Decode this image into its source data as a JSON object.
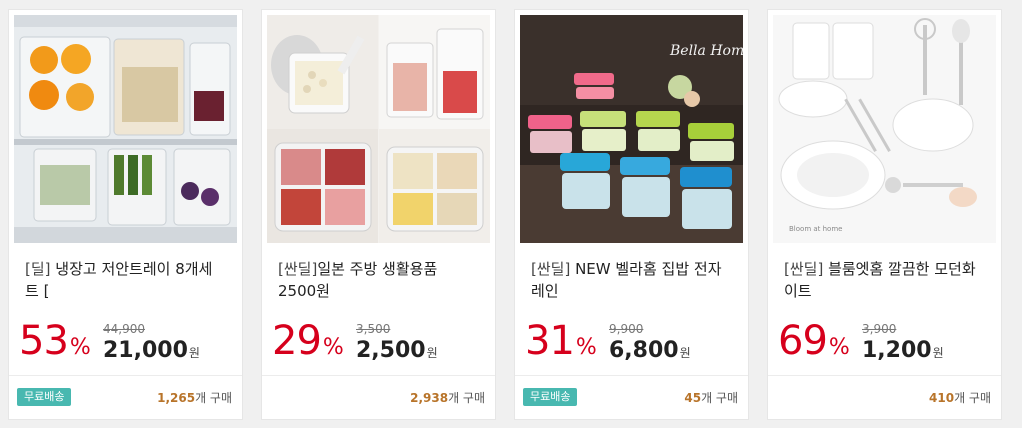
{
  "products": [
    {
      "image": "fridge-tray-photo",
      "tag": "[딜]",
      "title": " 냉장고 저안트레이 8개세트 [",
      "discount": "53",
      "discount_unit": "%",
      "original_price": "44,900",
      "sale_price": "21,000",
      "currency": "원",
      "badge": "무료배송",
      "purchase_count": "1,265",
      "purchase_suffix": "개 구매"
    },
    {
      "image": "kitchen-container-photo",
      "tag": "[싼딜]",
      "title": "일본 주방 생활용품 2500원",
      "discount": "29",
      "discount_unit": "%",
      "original_price": "3,500",
      "sale_price": "2,500",
      "currency": "원",
      "badge": "",
      "purchase_count": "2,938",
      "purchase_suffix": "개 구매"
    },
    {
      "image": "bella-home-container-photo",
      "tag": "[싼딜]",
      "title": " NEW 벨라홈 집밥 전자레인",
      "discount": "31",
      "discount_unit": "%",
      "original_price": "9,900",
      "sale_price": "6,800",
      "currency": "원",
      "badge": "무료배송",
      "purchase_count": "45",
      "purchase_suffix": "개 구매",
      "image_logo": "Bella Home"
    },
    {
      "image": "white-tableware-photo",
      "tag": "[싼딜]",
      "title": " 블룸엣홈 깔끔한 모던화이트",
      "discount": "69",
      "discount_unit": "%",
      "original_price": "3,900",
      "sale_price": "1,200",
      "currency": "원",
      "badge": "",
      "purchase_count": "410",
      "purchase_suffix": "개 구매",
      "image_logo": "Bloom at home"
    }
  ],
  "colors": {
    "discount": "#d6001c",
    "badge_bg": "#48b8b0",
    "count": "#b8742a"
  }
}
